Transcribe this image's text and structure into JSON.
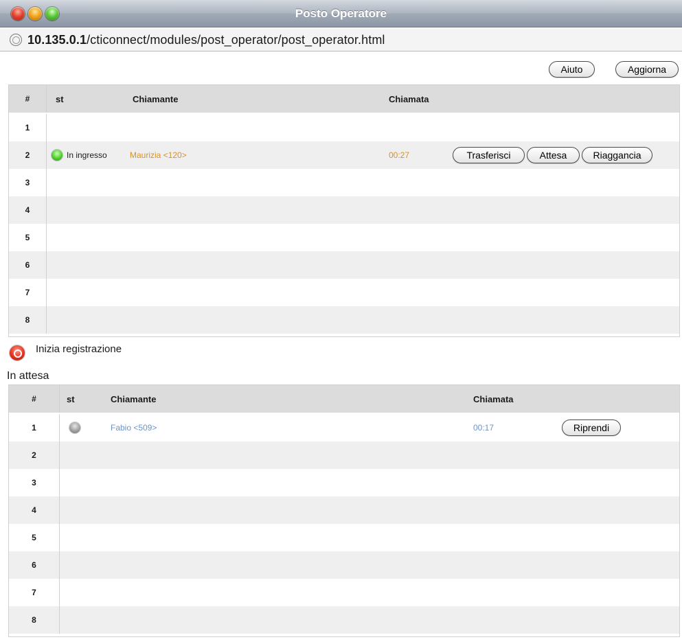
{
  "window": {
    "title": "Posto Operatore"
  },
  "url": {
    "host": "10.135.0.1",
    "path": "/cticonnect/modules/post_operator/post_operator.html"
  },
  "toolbar": {
    "help_label": "Aiuto",
    "refresh_label": "Aggiorna"
  },
  "active_calls": {
    "columns": {
      "num": "#",
      "status": "st",
      "caller": "Chiamante",
      "call": "Chiamata"
    },
    "rows": [
      {
        "num": "1"
      },
      {
        "num": "2",
        "status": "In ingresso",
        "status_color": "green",
        "caller": "Maurizia <120>",
        "duration": "00:27",
        "actions": {
          "transfer": "Trasferisci",
          "hold": "Attesa",
          "hangup": "Riaggancia"
        }
      },
      {
        "num": "3"
      },
      {
        "num": "4"
      },
      {
        "num": "5"
      },
      {
        "num": "6"
      },
      {
        "num": "7"
      },
      {
        "num": "8"
      }
    ]
  },
  "recording": {
    "label": "Inizia registrazione"
  },
  "on_hold": {
    "title": "In attesa",
    "columns": {
      "num": "#",
      "status": "st",
      "caller": "Chiamante",
      "call": "Chiamata"
    },
    "rows": [
      {
        "num": "1",
        "status_color": "gray",
        "caller": "Fabio <509>",
        "duration": "00:17",
        "actions": {
          "resume": "Riprendi"
        }
      },
      {
        "num": "2"
      },
      {
        "num": "3"
      },
      {
        "num": "4"
      },
      {
        "num": "5"
      },
      {
        "num": "6"
      },
      {
        "num": "7"
      },
      {
        "num": "8"
      }
    ]
  },
  "colors": {
    "caller_active": "#d4922b",
    "caller_hold": "#6c94c8",
    "status_active": "#4fce2a",
    "status_hold": "#9a9a9a"
  }
}
